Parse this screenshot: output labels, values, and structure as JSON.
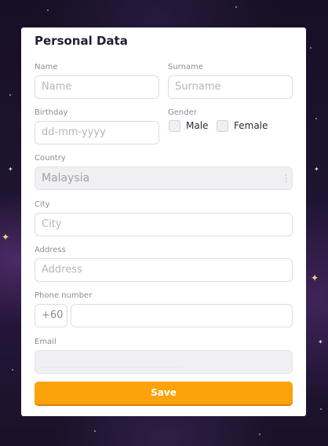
{
  "form": {
    "title": "Personal Data",
    "name": {
      "label": "Name",
      "placeholder": "Name"
    },
    "surname": {
      "label": "Surname",
      "placeholder": "Surname"
    },
    "birthday": {
      "label": "Birthday",
      "placeholder": "dd-mm-yyyy"
    },
    "gender": {
      "label": "Gender",
      "options": [
        "Male",
        "Female"
      ]
    },
    "country": {
      "label": "Country",
      "value": "Malaysia"
    },
    "city": {
      "label": "City",
      "placeholder": "City"
    },
    "address": {
      "label": "Address",
      "placeholder": "Address"
    },
    "phone": {
      "label": "Phone number",
      "prefix": "+60",
      "value": ""
    },
    "email": {
      "label": "Email",
      "value": ""
    },
    "save_label": "Save"
  },
  "colors": {
    "accent": "#fca20a",
    "background": "#1d1430"
  }
}
